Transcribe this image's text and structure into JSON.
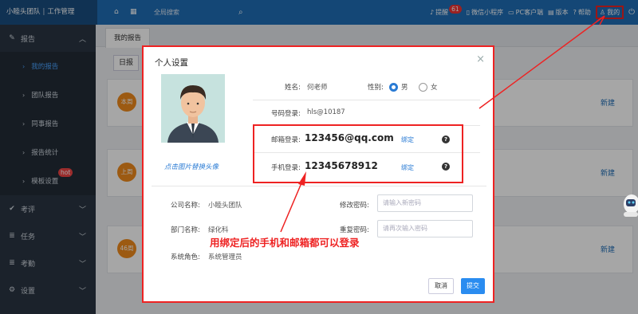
{
  "topbar": {
    "brand": "小睦头团队",
    "brand_sub": "工作管理",
    "search_label": "全局搜索",
    "items": [
      {
        "label": "提醒",
        "badge": "61",
        "icon": "bell-icon"
      },
      {
        "label": "微信小程序",
        "icon": "mobile-icon"
      },
      {
        "label": "PC客户端",
        "icon": "monitor-icon"
      },
      {
        "label": "版本",
        "icon": "doc-icon"
      },
      {
        "label": "帮助",
        "icon": "question-icon"
      }
    ],
    "mine": "我的"
  },
  "sidebar": {
    "report": "报告",
    "sub": [
      {
        "label": "我的报告"
      },
      {
        "label": "团队报告"
      },
      {
        "label": "同事报告"
      },
      {
        "label": "报告统计"
      },
      {
        "label": "模板设置"
      }
    ],
    "hot": "hot",
    "groups": [
      {
        "label": "考评"
      },
      {
        "label": "任务"
      },
      {
        "label": "考勤"
      },
      {
        "label": "设置"
      }
    ]
  },
  "main": {
    "tab": "我的报告",
    "filter": "日报",
    "cards": [
      {
        "badge": "本周",
        "action": "新建"
      },
      {
        "badge": "上周",
        "action": "新建"
      },
      {
        "badge": "46周",
        "action": "新建"
      }
    ]
  },
  "modal": {
    "title": "个人设置",
    "close": "×",
    "avatar_link": "点击图片替换头像",
    "name_label": "姓名:",
    "name_value": "何老师",
    "gender_label": "性别:",
    "gender_male": "男",
    "gender_female": "女",
    "account_label": "号码登录:",
    "account_value": "hls@10187",
    "email_label": "邮箱登录:",
    "email_value": "123456@qq.com",
    "phone_label": "手机登录:",
    "phone_value": "12345678912",
    "bind": "绑定",
    "company_label": "公司名称:",
    "company_value": "小睦头团队",
    "dept_label": "部门名称:",
    "dept_value": "绿化科",
    "role_label": "系统角色:",
    "role_value": "系统管理员",
    "pwd_label": "修改密码:",
    "pwd_placeholder": "请输入新密码",
    "pwd2_label": "重复密码:",
    "pwd2_placeholder": "请再次输入密码",
    "cancel": "取消",
    "submit": "提交"
  },
  "annotation": "用绑定后的手机和邮箱都可以登录",
  "colors": {
    "topbar": "#1f6db5",
    "sidebar": "#2a3542",
    "accent": "#2a8cf0",
    "annotation": "#e22222"
  }
}
